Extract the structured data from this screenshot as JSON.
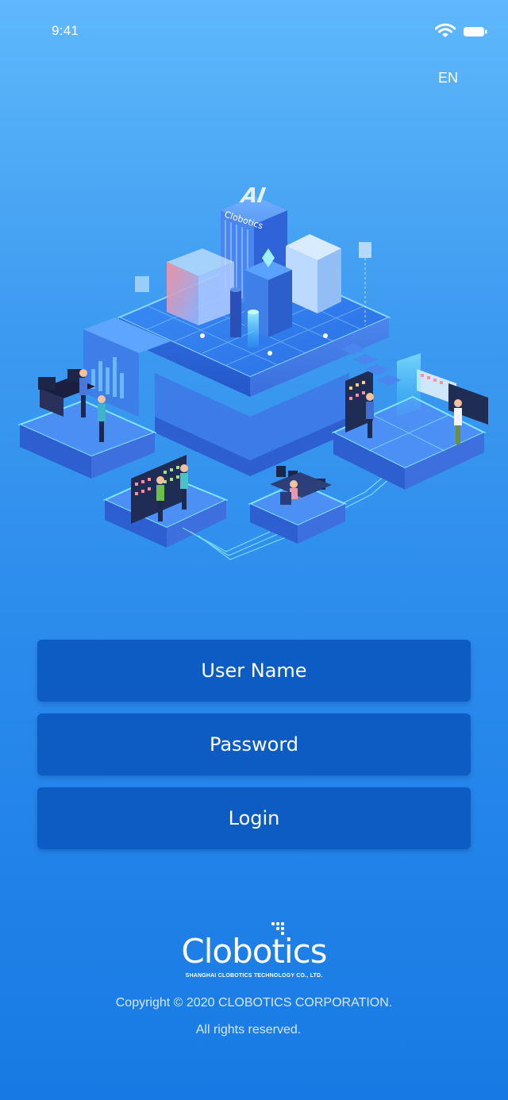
{
  "status_bar": {
    "time": "9:41"
  },
  "header": {
    "language_label": "EN"
  },
  "illustration": {
    "building_sign": "Clobotics",
    "tower_label": "AI"
  },
  "form": {
    "username_placeholder": "User Name",
    "password_placeholder": "Password",
    "login_label": "Login"
  },
  "footer": {
    "logo_text": "Clobotics",
    "logo_subtitle": "SHANGHAI CLOBOTICS TECHNOLOGY CO., LTD.",
    "copyright": "Copyright © 2020 CLOBOTICS CORPORATION.",
    "rights": "All rights reserved."
  },
  "colors": {
    "background_top": "#5fb8fb",
    "background_bottom": "#177ae4",
    "field_fill": "#0d5cc3"
  },
  "icons": [
    "wifi-icon",
    "battery-icon",
    "logo-dots-icon"
  ]
}
